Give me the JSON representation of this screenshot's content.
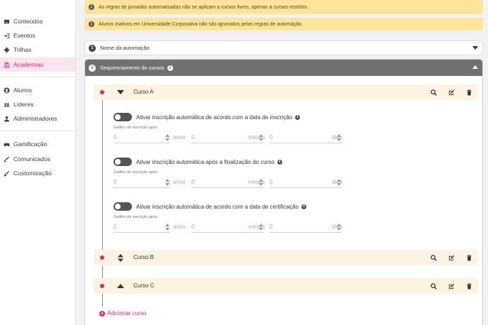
{
  "sidebar": {
    "items": [
      {
        "label": "Conteúdos",
        "icon": "inbox-icon"
      },
      {
        "label": "Eventos",
        "icon": "sign-in-icon"
      },
      {
        "label": "Trilhas",
        "icon": "gear-icon"
      },
      {
        "label": "Academias",
        "icon": "institution-icon"
      },
      {
        "label": "Alunos",
        "icon": "user-circle-icon"
      },
      {
        "label": "Líderes",
        "icon": "users-icon"
      },
      {
        "label": "Administradores",
        "icon": "user-admin-icon"
      },
      {
        "label": "Gamificação",
        "icon": "gamepad-icon"
      },
      {
        "label": "Comunicados",
        "icon": "pencil-brush-icon"
      },
      {
        "label": "Customização",
        "icon": "paint-brush-icon"
      }
    ],
    "active": "Academias"
  },
  "alerts": [
    "As regras de jornadas automatizadas não se aplicam a cursos livres, apenas a cursos restritos.",
    "Alunos inativos em Universidade Corporativa não são ignorados pelas regras de automação."
  ],
  "step1": {
    "number": "1",
    "title": "Nome da automação"
  },
  "step2": {
    "number": "2",
    "title": "Sequenciamento de cursos"
  },
  "courses": [
    {
      "name": "Curso A"
    },
    {
      "name": "Curso B"
    },
    {
      "name": "Curso C"
    }
  ],
  "rules": [
    {
      "label": "Ativar inscrição automática de acordo com a data de inscrição",
      "trigger_label": "Gatilho de inscrição após",
      "years": "0",
      "months": "0",
      "days": "0"
    },
    {
      "label": "Ativar inscrição automática após a finalização do curso",
      "trigger_label": "Gatilho de inscrição após",
      "years": "0",
      "months": "0",
      "days": "0"
    },
    {
      "label": "Ativar inscrição automática de acordo com a data de certificação",
      "trigger_label": "Gatilho de inscrição após",
      "years": "0",
      "months": "0",
      "days": "0"
    }
  ],
  "units": {
    "years": "anos",
    "months": "meses",
    "days": "dias"
  },
  "add_course_label": "Adicionar curso",
  "colors": {
    "accent": "#d6277e",
    "alert_bg": "#fce49a",
    "step_header": "#707070",
    "course_bg": "#fdf3e3"
  }
}
